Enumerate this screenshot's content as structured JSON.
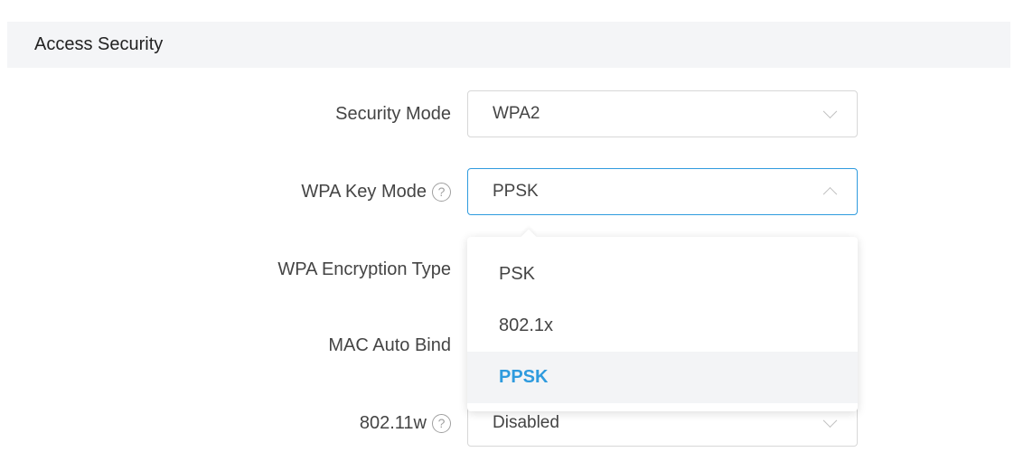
{
  "section": {
    "title": "Access Security"
  },
  "form": {
    "security_mode": {
      "label": "Security Mode",
      "value": "WPA2"
    },
    "wpa_key_mode": {
      "label": "WPA Key Mode",
      "value": "PPSK",
      "help": "?"
    },
    "wpa_encryption_type": {
      "label": "WPA Encryption Type"
    },
    "mac_auto_bind": {
      "label": "MAC Auto Bind"
    },
    "dot11w": {
      "label": "802.11w",
      "value": "Disabled",
      "help": "?"
    }
  },
  "dropdown": {
    "options": [
      {
        "label": "PSK"
      },
      {
        "label": "802.1x"
      },
      {
        "label": "PPSK"
      }
    ],
    "selected": "PPSK"
  },
  "colors": {
    "accent": "#2f9bde",
    "header_bg": "#f4f5f7",
    "selected_option_bg": "#f3f4f6"
  }
}
